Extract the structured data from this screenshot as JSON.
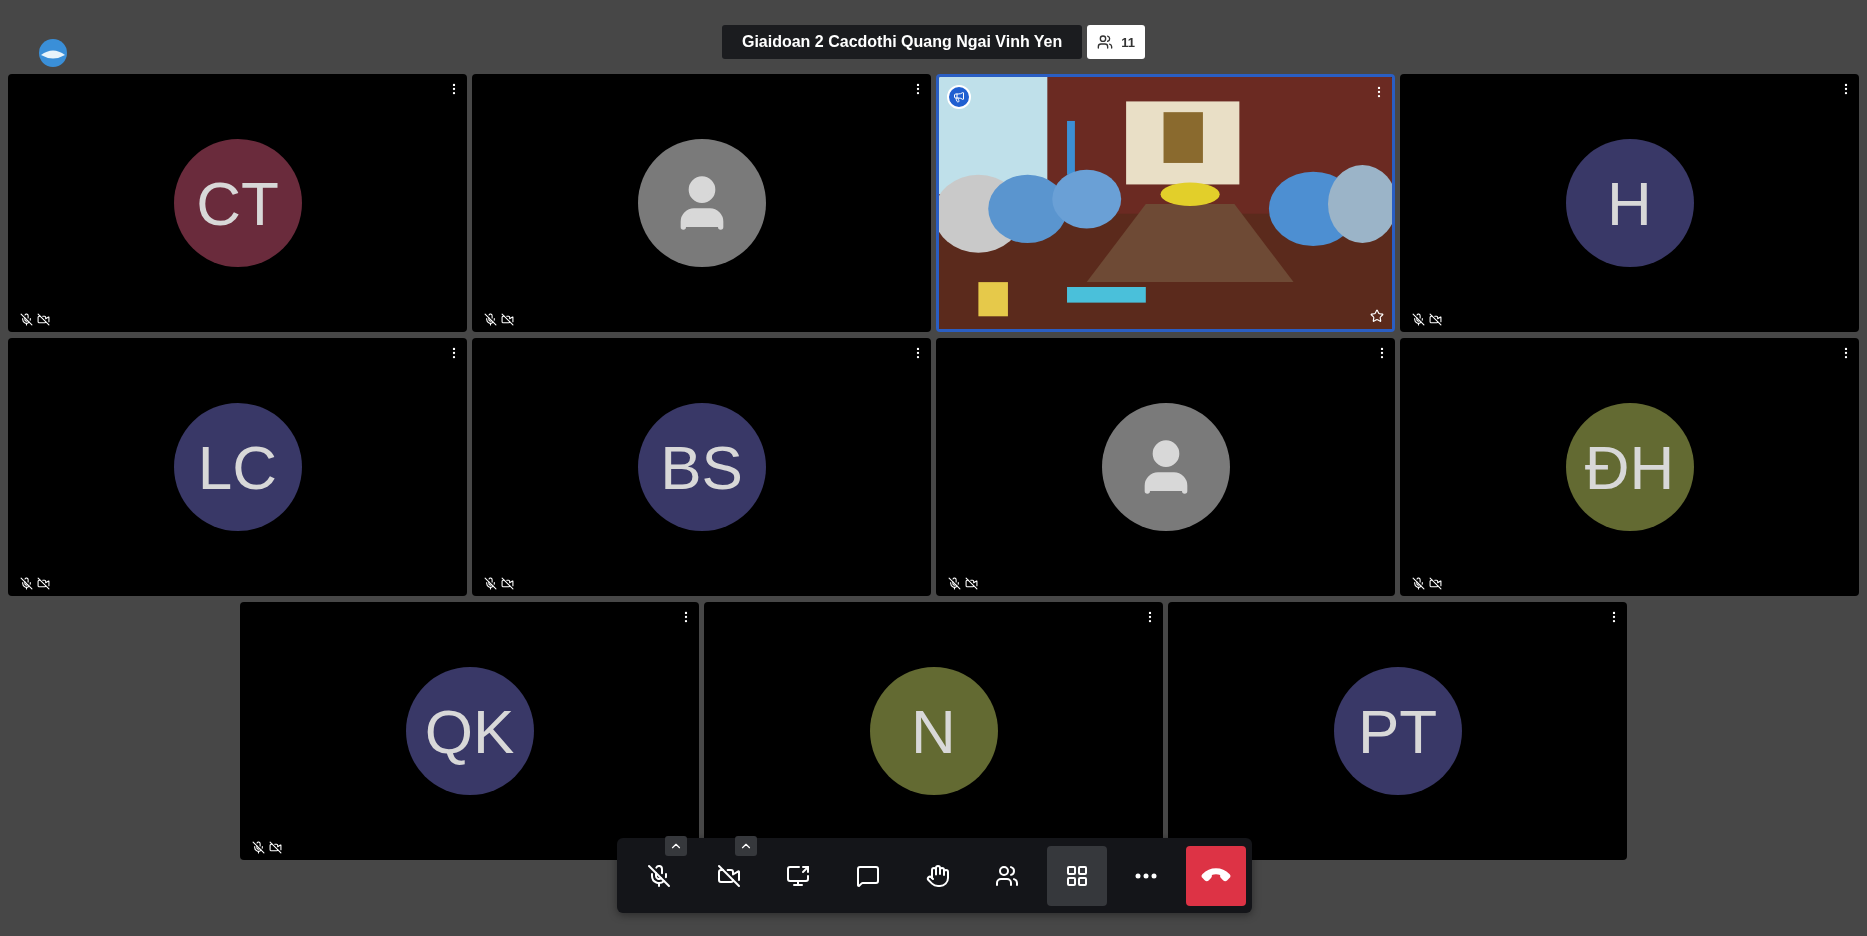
{
  "meeting": {
    "title": "Giaidoan 2 Cacdothi Quang Ngai Vinh Yen",
    "participant_count": "11"
  },
  "tiles": [
    {
      "kind": "avatar",
      "initials": "CT",
      "color": "#6a2b3c",
      "dominant": false,
      "audio_muted": true,
      "video_muted": true
    },
    {
      "kind": "placeholder",
      "color": "#7a7a7a",
      "dominant": false,
      "audio_muted": true,
      "video_muted": true
    },
    {
      "kind": "video",
      "dominant": true,
      "audio_muted": false,
      "video_muted": false
    },
    {
      "kind": "avatar",
      "initials": "H",
      "color": "#393867",
      "dominant": false,
      "audio_muted": true,
      "video_muted": true
    },
    {
      "kind": "avatar",
      "initials": "LC",
      "color": "#393867",
      "dominant": false,
      "audio_muted": true,
      "video_muted": true
    },
    {
      "kind": "avatar",
      "initials": "BS",
      "color": "#393867",
      "dominant": false,
      "audio_muted": true,
      "video_muted": true
    },
    {
      "kind": "placeholder",
      "color": "#7a7a7a",
      "dominant": false,
      "audio_muted": true,
      "video_muted": true
    },
    {
      "kind": "avatar",
      "initials": "ĐH",
      "color": "#636a32",
      "dominant": false,
      "audio_muted": true,
      "video_muted": true
    },
    {
      "kind": "avatar",
      "initials": "QK",
      "color": "#393867",
      "dominant": false,
      "audio_muted": true,
      "video_muted": true
    },
    {
      "kind": "avatar",
      "initials": "N",
      "color": "#636a32",
      "dominant": false
    },
    {
      "kind": "avatar",
      "initials": "PT",
      "color": "#393867",
      "dominant": false
    }
  ],
  "toolbar": {
    "buttons": [
      {
        "kind": "mic",
        "selected": false
      },
      {
        "kind": "camera",
        "selected": false
      },
      {
        "kind": "share",
        "selected": false
      },
      {
        "kind": "chat",
        "selected": false
      },
      {
        "kind": "hand",
        "selected": false
      },
      {
        "kind": "participants",
        "selected": false
      },
      {
        "kind": "tileview",
        "selected": true
      },
      {
        "kind": "more",
        "selected": false
      },
      {
        "kind": "hangup",
        "selected": false
      }
    ]
  }
}
